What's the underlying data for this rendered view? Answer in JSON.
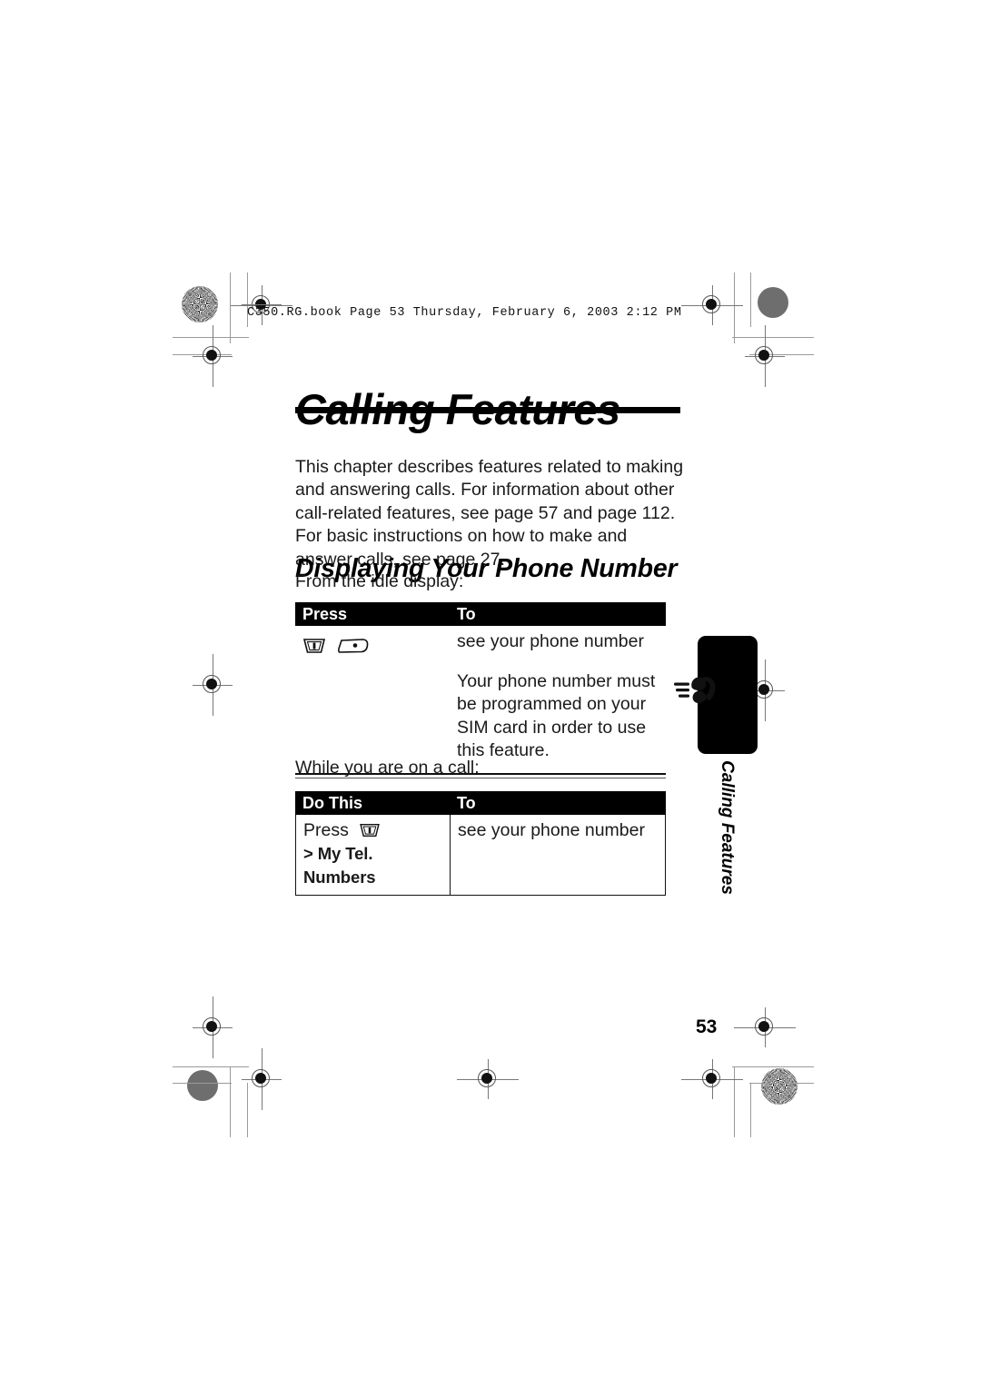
{
  "document": {
    "running_header": "C350.RG.book  Page 53  Thursday, February 6, 2003  2:12 PM",
    "chapter_title": "Calling Features",
    "page_number": "53",
    "side_tab_label": "Calling Features",
    "side_tab_icon": "ringing-phone-icon"
  },
  "intro": {
    "paragraph": "This chapter describes features related to making and answering calls. For information about other call-related features, see page 57 and page 112. For basic instructions on how to make and answer calls, see page 27."
  },
  "section": {
    "title": "Displaying Your Phone Number"
  },
  "table_one": {
    "lead_in": "From the idle display:",
    "headers": [
      "Press",
      "To"
    ],
    "row": {
      "keys": [
        "menu-key-icon",
        "pound-key-icon"
      ],
      "action": "see your phone number",
      "note": "Your phone number must be programmed on your SIM card in order to use this feature."
    }
  },
  "table_two": {
    "lead_in": "While you are on a call:",
    "headers": [
      "Do This",
      "To"
    ],
    "row": {
      "do_prefix": "Press",
      "do_key": "menu-key-icon",
      "do_path": "> My Tel. Numbers",
      "action": "see your phone number"
    }
  },
  "colors": {
    "ink": "#000000",
    "paper": "#ffffff",
    "header_bar": "#000000",
    "header_text": "#ffffff",
    "mark_gray": "#6e6e6e"
  }
}
